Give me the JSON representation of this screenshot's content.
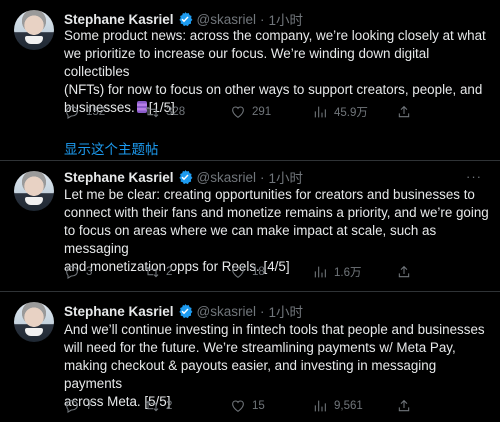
{
  "colors": {
    "background": "#000000",
    "text": "#e7e9ea",
    "muted": "#71767b",
    "link": "#1d9bf0",
    "verified": "#1d9bf0"
  },
  "tweets": [
    {
      "name": "Stephane Kasriel",
      "handle": "@skasriel",
      "sep": "·",
      "time": "1小时",
      "text_lines": [
        "Some product news: across the company, we’re looking closely at what",
        "we prioritize to increase our focus. We’re winding down digital collectibles",
        "(NFTs) for now to focus on other ways to support creators, people, and"
      ],
      "last_line_pre": "businesses.",
      "last_line_post": "[1/5]",
      "replies": "152",
      "retweets": "328",
      "likes": "291",
      "views": "45.9万"
    },
    {
      "name": "Stephane Kasriel",
      "handle": "@skasriel",
      "sep": "·",
      "time": "1小时",
      "text_lines": [
        "Let me be clear: creating opportunities for creators and businesses to",
        "connect with their fans and monetize remains a priority, and we’re going",
        "to focus on areas where we can make impact at scale, such as messaging",
        "and monetization opps for Reels. [4/5]"
      ],
      "replies": "3",
      "retweets": "2",
      "likes": "18",
      "views": "1.6万"
    },
    {
      "name": "Stephane Kasriel",
      "handle": "@skasriel",
      "sep": "·",
      "time": "1小时",
      "text_lines": [
        "And we’ll continue investing in fintech tools that people and businesses",
        "will need for the future. We’re streamlining payments w/ Meta Pay,",
        "making checkout & payouts easier, and investing in messaging payments",
        "across Meta. [5/5]"
      ],
      "replies": "7",
      "retweets": "2",
      "likes": "15",
      "views": "9,561"
    }
  ],
  "show_thread": "显示这个主题帖",
  "more_label": "···",
  "icons": [
    "reply-icon",
    "retweet-icon",
    "like-icon",
    "views-icon",
    "share-icon",
    "verified-badge-icon",
    "more-icon"
  ]
}
